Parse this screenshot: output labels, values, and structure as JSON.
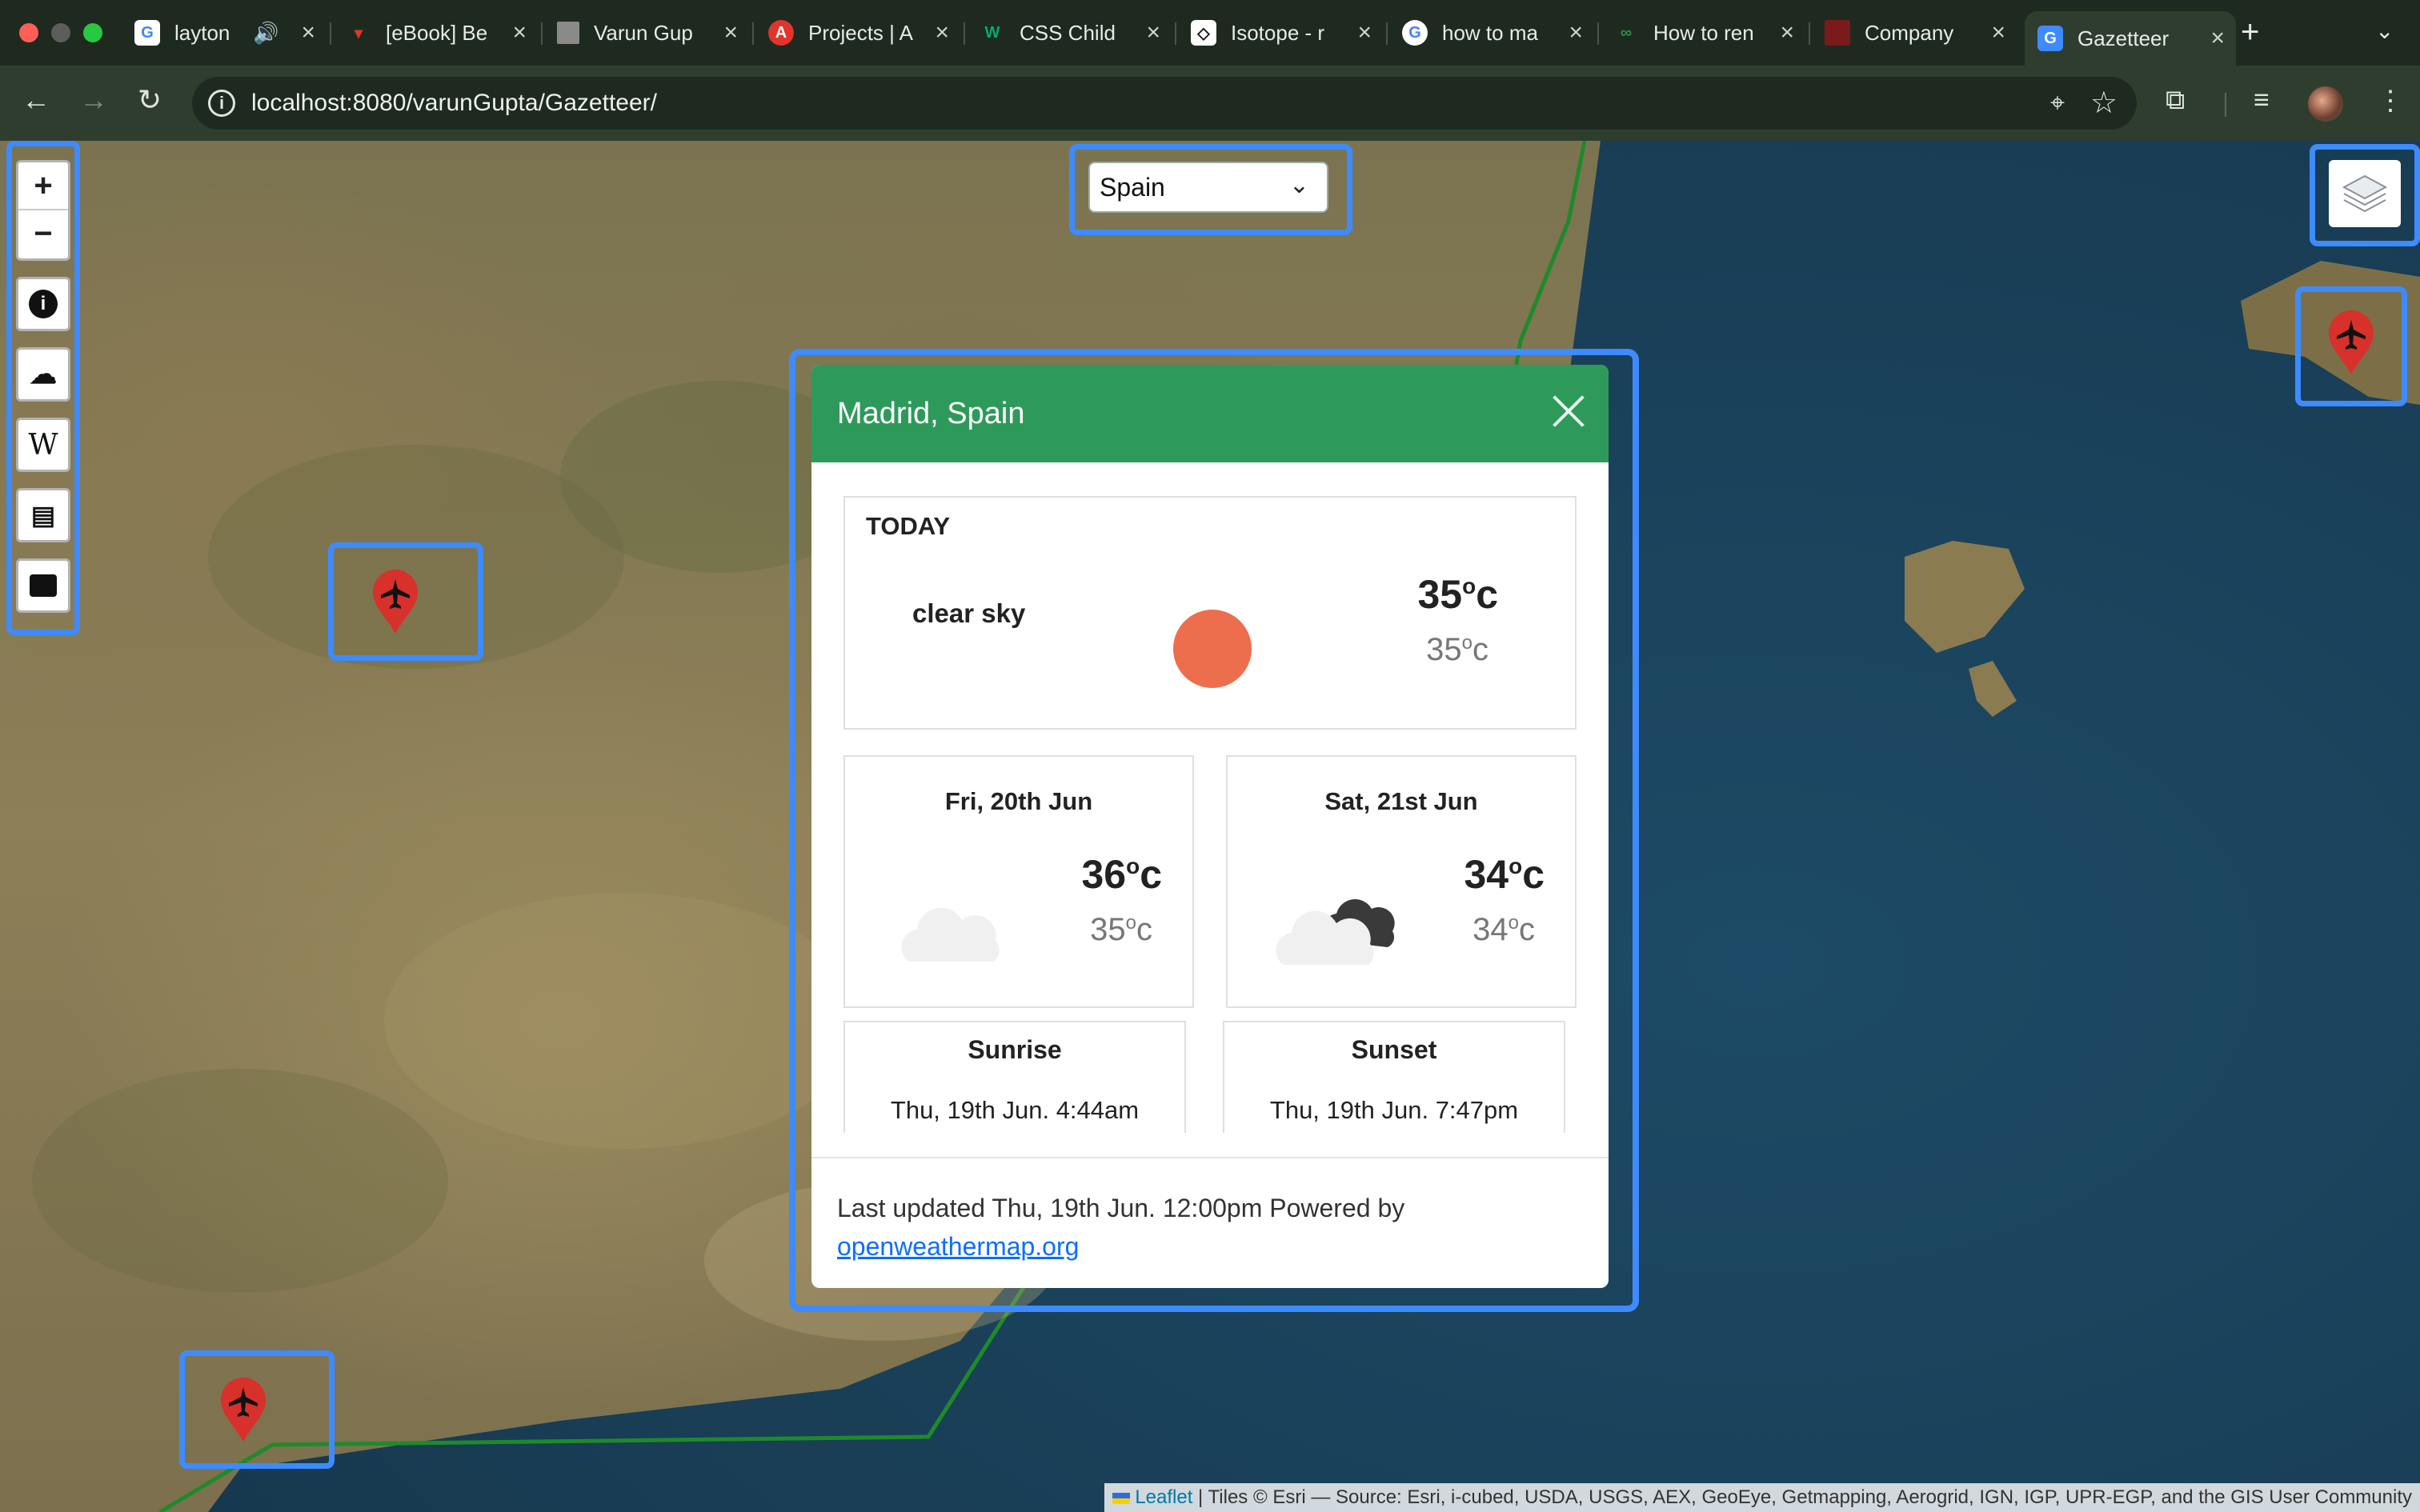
{
  "browser": {
    "tabs": [
      {
        "label": "layton",
        "favicon": "google-icon",
        "muted_icon": true
      },
      {
        "label": "[eBook] Be",
        "favicon": "ebook-icon"
      },
      {
        "label": "Varun Gup",
        "favicon": "page-icon"
      },
      {
        "label": "Projects | A",
        "favicon": "projects-icon"
      },
      {
        "label": "CSS Child",
        "favicon": "w3-icon"
      },
      {
        "label": "Isotope - r",
        "favicon": "codepen-icon"
      },
      {
        "label": "how to ma",
        "favicon": "google-icon"
      },
      {
        "label": "How to ren",
        "favicon": "gfg-icon"
      },
      {
        "label": "Company",
        "favicon": "company-icon"
      },
      {
        "label": "Gazetteer",
        "favicon": "gazetteer-icon",
        "active": true
      }
    ],
    "url": "localhost:8080/varunGupta/Gazetteer/"
  },
  "map": {
    "country_select": {
      "value": "Spain"
    },
    "controls": [
      "zoom-in",
      "zoom-out",
      "info",
      "weather",
      "wikipedia",
      "news",
      "currency"
    ],
    "zoom_in_label": "+",
    "zoom_out_label": "−",
    "attribution": {
      "leaflet_link": "Leaflet",
      "text": " | Tiles © Esri — Source: Esri, i-cubed, USDA, USGS, AEX, GeoEye, Getmapping, Aerogrid, IGN, IGP, UPR-EGP, and the GIS User Community"
    }
  },
  "weather_modal": {
    "title": "Madrid, Spain",
    "today": {
      "label": "TODAY",
      "description": "clear sky",
      "max": "35",
      "min": "35",
      "unit": "c",
      "icon": "clear-sky-icon"
    },
    "forecast": [
      {
        "date": "Fri, 20th Jun",
        "max": "36",
        "min": "35",
        "icon": "cloud-icon"
      },
      {
        "date": "Sat, 21st Jun",
        "max": "34",
        "min": "34",
        "icon": "broken-clouds-icon"
      }
    ],
    "sunrise": {
      "title": "Sunrise",
      "time": "Thu, 19th Jun. 4:44am"
    },
    "sunset": {
      "title": "Sunset",
      "time": "Thu, 19th Jun. 7:47pm"
    },
    "footer": {
      "text": "Last updated Thu, 19th Jun. 12:00pm Powered by",
      "link": "openweathermap.org"
    }
  },
  "colors": {
    "header_green": "#2e9a5a",
    "highlight_blue": "#3d8bff",
    "sun_orange": "#ec6e4c",
    "marker_red": "#d8302a"
  }
}
